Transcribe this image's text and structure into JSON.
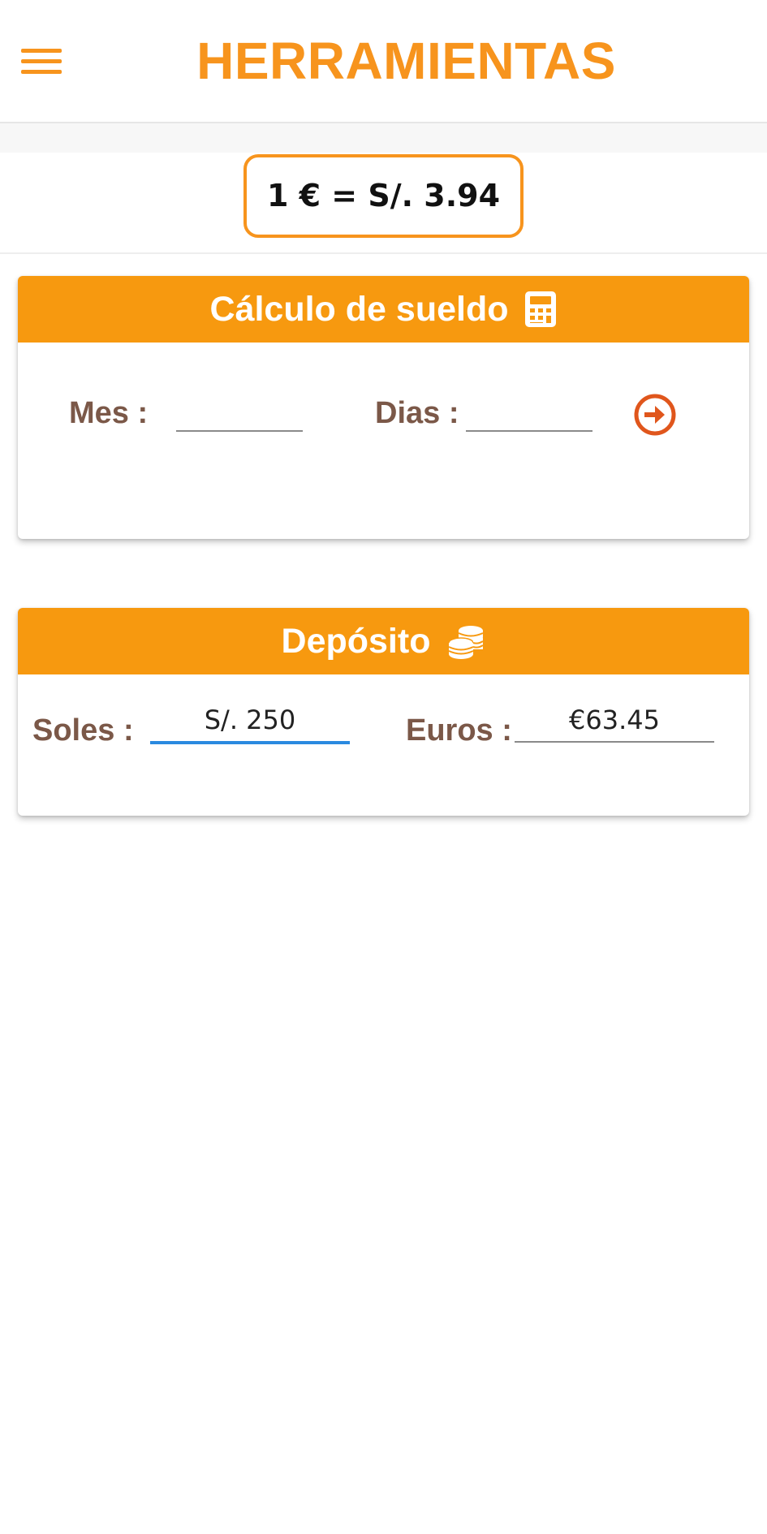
{
  "app": {
    "title": "HERRAMIENTAS"
  },
  "rate": {
    "text": "1 €  =  S/. 3.94"
  },
  "salary": {
    "title": "Cálculo de sueldo",
    "icon": "calculator-icon",
    "mes_label": "Mes :",
    "mes_value": "",
    "dias_label": "Dias :",
    "dias_value": "",
    "go_icon": "arrow-right-circle-icon"
  },
  "deposit": {
    "title": "Depósito",
    "icon": "coins-icon",
    "soles_label": "Soles :",
    "soles_value": "S/. 250",
    "euros_label": "Euros :",
    "euros_value": "€63.45"
  },
  "colors": {
    "accent": "#f7941d",
    "header_bg": "#f7990f",
    "label": "#7b5848",
    "focus": "#2a8ae0",
    "go_button": "#e0561c"
  }
}
